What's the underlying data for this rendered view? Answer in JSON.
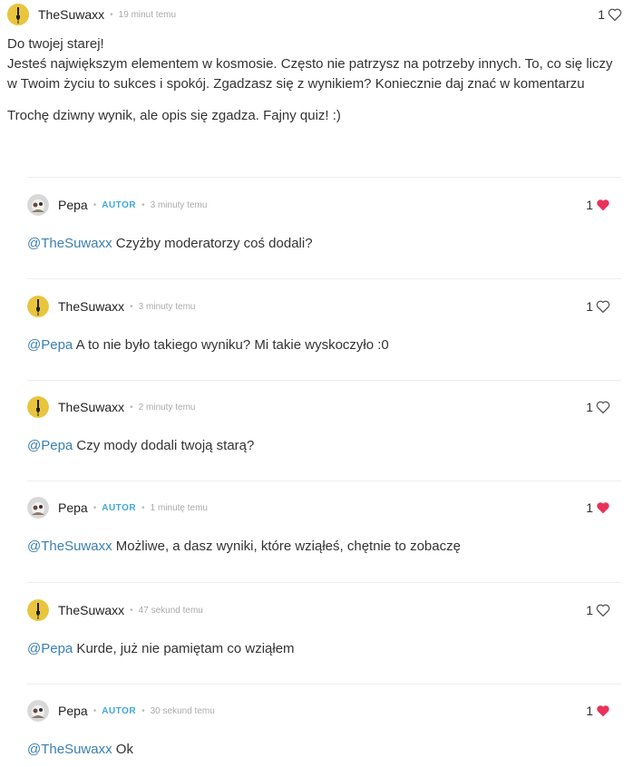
{
  "main_comment": {
    "user": "TheSuwaxx",
    "time": "19 minut temu",
    "likes": "1",
    "liked": false,
    "p1": "Do twojej starej!",
    "p2": "Jesteś największym elementem w kosmosie. Często nie patrzysz na potrzeby innych. To, co się liczy w Twoim życiu to sukces i spokój. Zgadzasz się z wynikiem? Koniecznie daj znać w komentarzu",
    "p3": "Trochę dziwny wynik, ale opis się zgadza. Fajny quiz! :)"
  },
  "replies": [
    {
      "user": "Pepa",
      "badge": "AUTOR",
      "time": "3 minuty temu",
      "likes": "1",
      "liked": true,
      "mention": "@TheSuwaxx",
      "text": " Czyżby moderatorzy coś dodali?"
    },
    {
      "user": "TheSuwaxx",
      "badge": "",
      "time": "3 minuty temu",
      "likes": "1",
      "liked": false,
      "mention": "@Pepa",
      "text": " A to nie było takiego wyniku? Mi takie wyskoczyło :0"
    },
    {
      "user": "TheSuwaxx",
      "badge": "",
      "time": "2 minuty temu",
      "likes": "1",
      "liked": false,
      "mention": "@Pepa",
      "text": " Czy mody dodali twoją starą?"
    },
    {
      "user": "Pepa",
      "badge": "AUTOR",
      "time": "1 minutę temu",
      "likes": "1",
      "liked": true,
      "mention": "@TheSuwaxx",
      "text": " Możliwe, a dasz wyniki, które wziąłeś, chętnie to zobaczę"
    },
    {
      "user": "TheSuwaxx",
      "badge": "",
      "time": "47 sekund temu",
      "likes": "1",
      "liked": false,
      "mention": "@Pepa",
      "text": " Kurde, już nie pamiętam co wziąłem"
    },
    {
      "user": "Pepa",
      "badge": "AUTOR",
      "time": "30 sekund temu",
      "likes": "1",
      "liked": true,
      "mention": "@TheSuwaxx",
      "text": " Ok"
    }
  ],
  "colors": {
    "mention": "#3a7fb0",
    "autor": "#3fa9dc",
    "heart_filled": "#e8325a"
  }
}
